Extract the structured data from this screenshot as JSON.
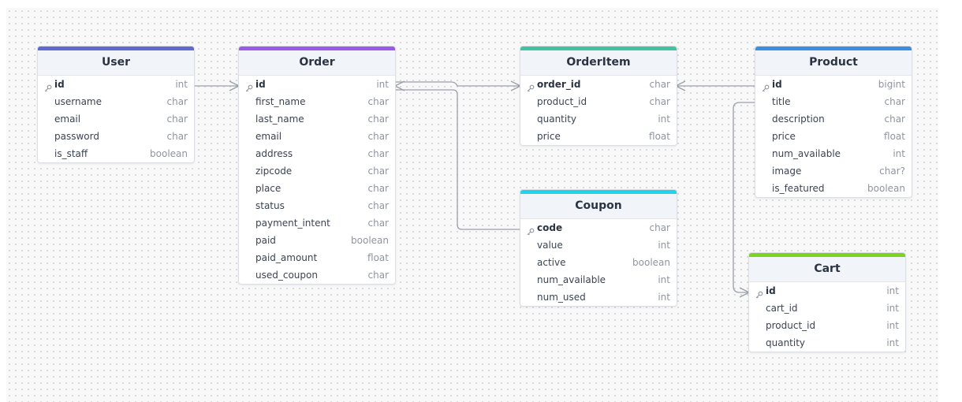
{
  "tables": [
    {
      "id": "user",
      "name": "User",
      "accent": "#5e6ad2",
      "fields": [
        {
          "name": "id",
          "type": "int",
          "pk": true
        },
        {
          "name": "username",
          "type": "char"
        },
        {
          "name": "email",
          "type": "char"
        },
        {
          "name": "password",
          "type": "char"
        },
        {
          "name": "is_staff",
          "type": "boolean"
        }
      ]
    },
    {
      "id": "order",
      "name": "Order",
      "accent": "#9b59e8",
      "fields": [
        {
          "name": "id",
          "type": "int",
          "pk": true
        },
        {
          "name": "first_name",
          "type": "char"
        },
        {
          "name": "last_name",
          "type": "char"
        },
        {
          "name": "email",
          "type": "char"
        },
        {
          "name": "address",
          "type": "char"
        },
        {
          "name": "zipcode",
          "type": "char"
        },
        {
          "name": "place",
          "type": "char"
        },
        {
          "name": "status",
          "type": "char"
        },
        {
          "name": "payment_intent",
          "type": "char"
        },
        {
          "name": "paid",
          "type": "boolean"
        },
        {
          "name": "paid_amount",
          "type": "float"
        },
        {
          "name": "used_coupon",
          "type": "char"
        }
      ]
    },
    {
      "id": "orderitem",
      "name": "OrderItem",
      "accent": "#40c4a0",
      "fields": [
        {
          "name": "order_id",
          "type": "char",
          "pk": true
        },
        {
          "name": "product_id",
          "type": "char"
        },
        {
          "name": "quantity",
          "type": "int"
        },
        {
          "name": "price",
          "type": "float"
        }
      ]
    },
    {
      "id": "product",
      "name": "Product",
      "accent": "#3b8fe0",
      "fields": [
        {
          "name": "id",
          "type": "bigint",
          "pk": true
        },
        {
          "name": "title",
          "type": "char"
        },
        {
          "name": "description",
          "type": "char"
        },
        {
          "name": "price",
          "type": "float"
        },
        {
          "name": "num_available",
          "type": "int"
        },
        {
          "name": "image",
          "type": "char?"
        },
        {
          "name": "is_featured",
          "type": "boolean"
        }
      ]
    },
    {
      "id": "coupon",
      "name": "Coupon",
      "accent": "#22d3ee",
      "fields": [
        {
          "name": "code",
          "type": "char",
          "pk": true
        },
        {
          "name": "value",
          "type": "int"
        },
        {
          "name": "active",
          "type": "boolean"
        },
        {
          "name": "num_available",
          "type": "int"
        },
        {
          "name": "num_used",
          "type": "int"
        }
      ]
    },
    {
      "id": "cart",
      "name": "Cart",
      "accent": "#7ed321",
      "fields": [
        {
          "name": "id",
          "type": "int",
          "pk": true
        },
        {
          "name": "cart_id",
          "type": "int"
        },
        {
          "name": "product_id",
          "type": "int"
        },
        {
          "name": "quantity",
          "type": "int"
        }
      ]
    }
  ],
  "relationships": [
    {
      "from": "User.id",
      "to": "Order.id",
      "cardinality": "one-to-many"
    },
    {
      "from": "Order.id",
      "to": "OrderItem.order_id",
      "cardinality": "many-to-many"
    },
    {
      "from": "Order.id",
      "to": "Coupon.code",
      "cardinality": "many-to-one"
    },
    {
      "from": "OrderItem.order_id",
      "to": "Product.id",
      "cardinality": "many-to-one"
    },
    {
      "from": "Product.id",
      "to": "Cart.id",
      "cardinality": "one-to-many"
    }
  ],
  "colors": {
    "line": "#9aa0a8",
    "key_icon": "#8f959e"
  },
  "icons": {
    "primary_key": "key-icon"
  }
}
